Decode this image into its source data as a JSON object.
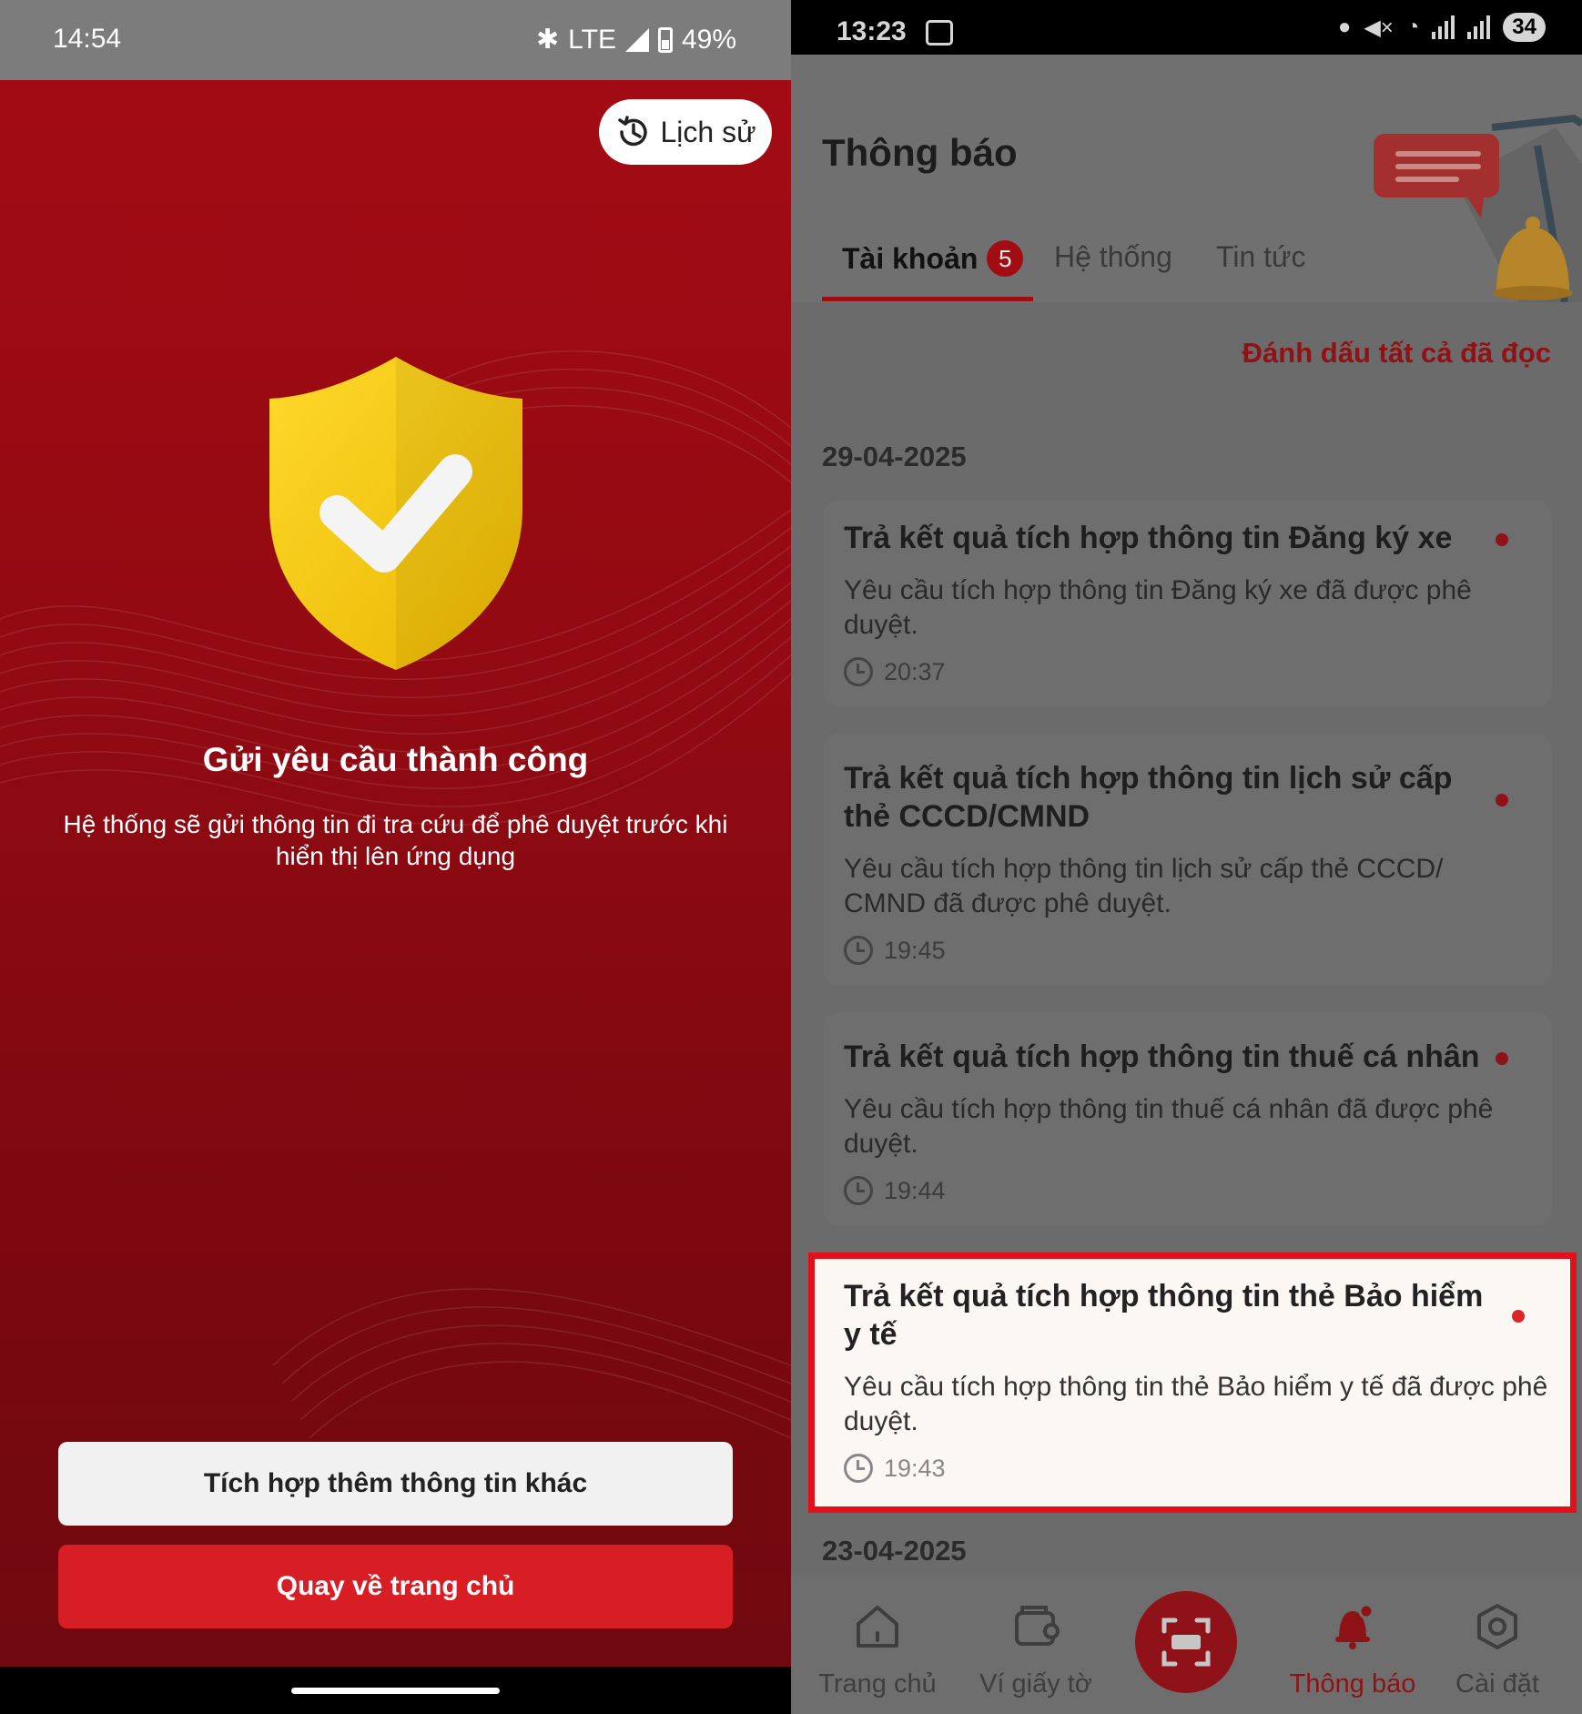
{
  "left": {
    "status_bar": {
      "time": "14:54",
      "network": "LTE",
      "battery": "49%"
    },
    "history_button": "Lịch sử",
    "success_title": "Gửi yêu cầu thành công",
    "success_description": "Hệ thống sẽ gửi thông tin đi tra cứu để phê duyệt trước khi hiển thị lên ứng dụng",
    "secondary_button": "Tích hợp thêm thông tin khác",
    "primary_button": "Quay về trang chủ",
    "colors": {
      "background": "#a50b14",
      "primary_button": "#d81e25",
      "shield": "#f2c70a"
    }
  },
  "right": {
    "status_bar": {
      "time": "13:23",
      "battery": "34"
    },
    "page_title": "Thông báo",
    "tabs": [
      {
        "label": "Tài khoản",
        "badge": "5",
        "active": true
      },
      {
        "label": "Hệ thống",
        "active": false
      },
      {
        "label": "Tin tức",
        "active": false
      }
    ],
    "mark_all_read": "Đánh dấu tất cả đã đọc",
    "groups": [
      {
        "date": "29-04-2025",
        "notifications": [
          {
            "title": "Trả kết quả tích hợp thông tin Đăng ký xe",
            "body": "Yêu cầu tích hợp thông tin Đăng ký xe đã được phê duyệt.",
            "time": "20:37",
            "unread": true
          },
          {
            "title": "Trả kết quả tích hợp thông tin lịch sử cấp thẻ CCCD/CMND",
            "body": "Yêu cầu tích hợp thông tin lịch sử cấp thẻ CCCD/ CMND đã được phê duyệt.",
            "time": "19:45",
            "unread": true
          },
          {
            "title": "Trả kết quả tích hợp thông tin thuế cá nhân",
            "body": "Yêu cầu tích hợp thông tin thuế cá nhân đã được phê duyệt.",
            "time": "19:44",
            "unread": true
          },
          {
            "title": "Trả kết quả tích hợp thông tin thẻ Bảo hiểm y tế",
            "body": "Yêu cầu tích hợp thông tin thẻ Bảo hiểm y tế đã được phê duyệt.",
            "time": "19:43",
            "unread": true,
            "highlighted": true
          }
        ]
      },
      {
        "date": "23-04-2025",
        "notifications": []
      }
    ],
    "bottom_nav": [
      {
        "label": "Trang chủ",
        "icon": "home-icon"
      },
      {
        "label": "Ví giấy tờ",
        "icon": "wallet-icon"
      },
      {
        "label": "",
        "icon": "scan-icon"
      },
      {
        "label": "Thông báo",
        "icon": "bell-icon",
        "active": true
      },
      {
        "label": "Cài đặt",
        "icon": "settings-icon"
      }
    ],
    "colors": {
      "accent": "#e0232b",
      "highlight_border": "#e3101c"
    }
  }
}
